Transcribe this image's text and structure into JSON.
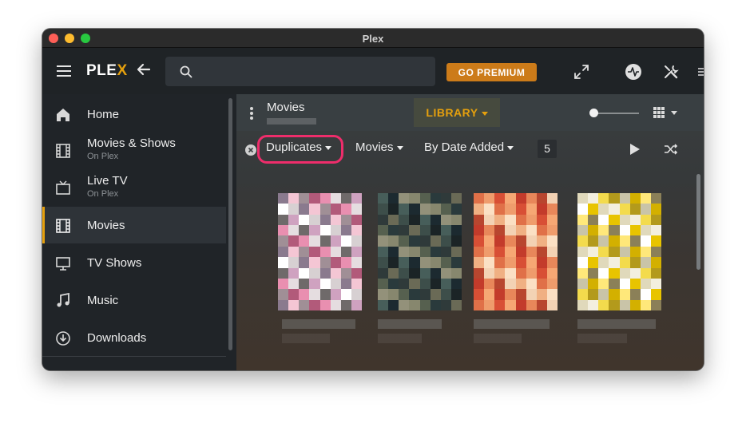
{
  "window": {
    "title": "Plex"
  },
  "topbar": {
    "logo_main": "PLE",
    "logo_x": "X",
    "search_placeholder": "",
    "premium_label": "GO PREMIUM"
  },
  "sidebar": {
    "items": [
      {
        "label": "Home",
        "sub": "",
        "icon": "home-icon"
      },
      {
        "label": "Movies & Shows",
        "sub": "On Plex",
        "icon": "film-icon"
      },
      {
        "label": "Live TV",
        "sub": "On Plex",
        "icon": "tv-icon"
      },
      {
        "label": "Movies",
        "sub": "",
        "icon": "film-icon",
        "active": true
      },
      {
        "label": "TV Shows",
        "sub": "",
        "icon": "monitor-icon"
      },
      {
        "label": "Music",
        "sub": "",
        "icon": "music-note-icon"
      },
      {
        "label": "Downloads",
        "sub": "",
        "icon": "download-icon"
      }
    ]
  },
  "library": {
    "title": "Movies",
    "library_label": "LIBRARY"
  },
  "filters": {
    "duplicates": "Duplicates",
    "type": "Movies",
    "sort": "By Date Added",
    "count": "5"
  },
  "colors": {
    "accent": "#e5a00d",
    "highlight": "#ee2d6b",
    "premium": "#cc7b19"
  }
}
